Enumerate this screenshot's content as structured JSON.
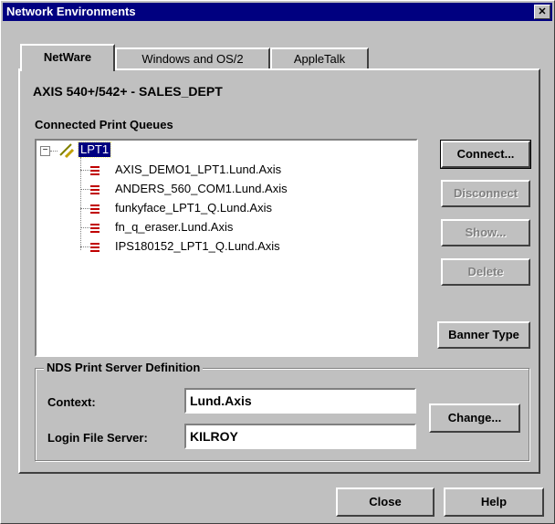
{
  "window": {
    "title": "Network Environments",
    "close_glyph": "✕"
  },
  "tabs": [
    {
      "label": "NetWare",
      "active": true
    },
    {
      "label": "Windows and OS/2",
      "active": false
    },
    {
      "label": "AppleTalk",
      "active": false
    }
  ],
  "device": {
    "title": "AXIS 540+/542+ - SALES_DEPT"
  },
  "queues": {
    "heading": "Connected Print Queues",
    "root": {
      "label": "LPT1",
      "expander": "−"
    },
    "items": [
      "AXIS_DEMO1_LPT1.Lund.Axis",
      "ANDERS_560_COM1.Lund.Axis",
      "funkyface_LPT1_Q.Lund.Axis",
      "fn_q_eraser.Lund.Axis",
      "IPS180152_LPT1_Q.Lund.Axis"
    ]
  },
  "side_buttons": {
    "connect": "Connect...",
    "disconnect": "Disconnect",
    "show": "Show...",
    "delete": "Delete",
    "banner": "Banner Type"
  },
  "nds": {
    "legend": "NDS Print Server Definition",
    "context_label": "Context:",
    "context_value": "Lund.Axis",
    "login_label": "Login File Server:",
    "login_value": "KILROY",
    "change": "Change..."
  },
  "footer": {
    "close": "Close",
    "help": "Help"
  },
  "colors": {
    "titlebar": "#000080",
    "face": "#c0c0c0",
    "selection": "#000080",
    "queue_icon": "#c00000"
  }
}
